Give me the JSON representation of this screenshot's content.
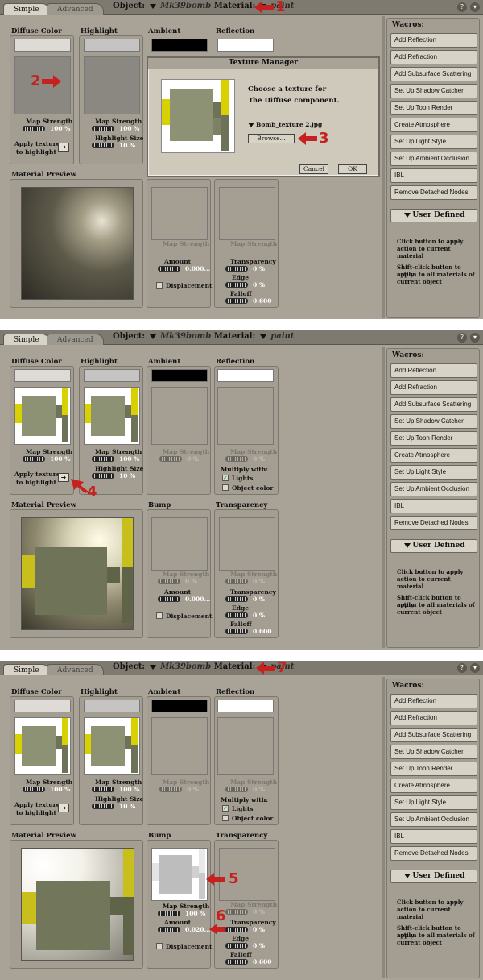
{
  "tabs": {
    "simple": "Simple",
    "advanced": "Advanced"
  },
  "objbar": {
    "object_label": "Object:",
    "object_value": "Mk39bomb",
    "material_label": "Material:",
    "material_value": "paint"
  },
  "columns": {
    "diffuse": "Diffuse Color",
    "highlight": "Highlight",
    "ambient": "Ambient",
    "reflection": "Reflection",
    "preview": "Material Preview",
    "bump": "Bump",
    "transparency": "Transparency"
  },
  "labels": {
    "map_strength": "Map Strength",
    "highlight_size": "Highlight Size",
    "apply_line1": "Apply texture",
    "apply_line2": "to highlight",
    "amount": "Amount",
    "transparency": "Transparency",
    "edge": "Edge",
    "falloff": "Falloff",
    "displacement": "Displacement",
    "multiply_with": "Multiply with:",
    "lights": "Lights",
    "object_color": "Object color"
  },
  "values": {
    "hundred": "100 %",
    "ten": "10 %",
    "zero": "0 %",
    "amount_zero": "0.000...",
    "amount_bump": "0.020...",
    "falloff": "0.600"
  },
  "wacros": {
    "title": "Wacros:",
    "buttons": [
      "Add Reflection",
      "Add Refraction",
      "Add Subsurface Scattering",
      "Set Up Shadow Catcher",
      "Set Up Toon Render",
      "Create Atmosphere",
      "Set Up Light Style",
      "Set Up Ambient Occlusion",
      "IBL",
      "Remove Detached Nodes"
    ],
    "user_defined": "User Defined",
    "note1": [
      "Click button to apply",
      "action to current material"
    ],
    "note2": [
      "Shift-click button to apply",
      "action to all materials of",
      "current object"
    ]
  },
  "dialog": {
    "title": "Texture Manager",
    "line1": "Choose a texture for",
    "line2": "the Diffuse component.",
    "file": "Bomb_texture 2.jpg",
    "browse": "Browse...",
    "cancel": "Cancel",
    "ok": "OK"
  },
  "markers": {
    "m1": "1",
    "m2": "2",
    "m3": "3",
    "m4": "4",
    "m5": "5",
    "m6": "6",
    "m7": "7"
  },
  "colors": {
    "panel_bg": "#a9a397",
    "arrow_red": "#c6211f",
    "button_bg": "#d8d3c7"
  }
}
